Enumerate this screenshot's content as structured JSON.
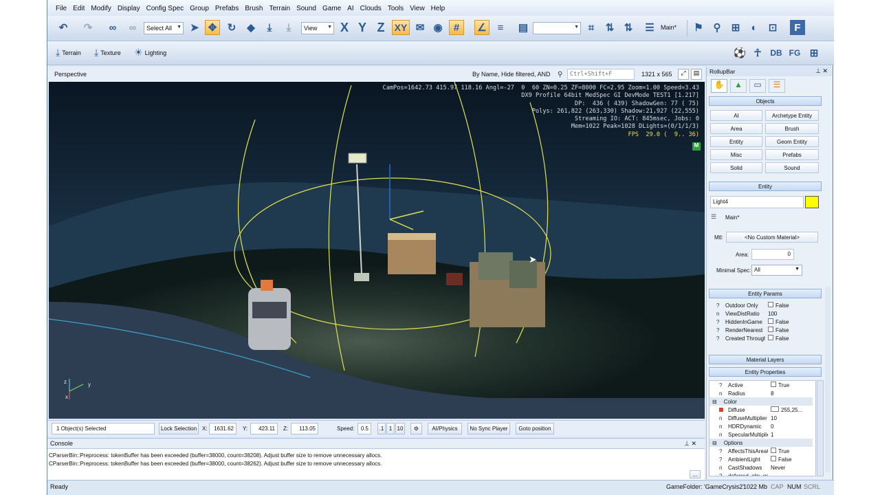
{
  "menu": [
    "File",
    "Edit",
    "Modify",
    "Display",
    "Config Spec",
    "Group",
    "Prefabs",
    "Brush",
    "Terrain",
    "Sound",
    "Game",
    "AI",
    "Clouds",
    "Tools",
    "View",
    "Help"
  ],
  "toolbar": {
    "select_mode": "Select All",
    "coord_system": "View",
    "axis_x": "X",
    "axis_y": "Y",
    "axis_z": "Z",
    "axis_xy": "XY",
    "layer": "Main*"
  },
  "toolbar2": {
    "terrain": "Terrain",
    "texture": "Texture",
    "lighting": "Lighting",
    "db": "DB",
    "fg": "FG"
  },
  "viewport": {
    "title": "Perspective",
    "filter": "By Name, Hide filtered, AND",
    "search_placeholder": "Ctrl+Shift+F",
    "resolution": "1321 x 565",
    "osd_lines": [
      "CamPos=1642.73 415.97 118.16 Angl=-27  0  60 ZN=0.25 ZF=8000 FC=2.95 Zoom=1.00 Speed=3.43",
      "DX9 Profile 64bit MedSpec GI DevMode TEST1 [1.217]",
      "DP:  436 ( 439) ShadowGen: 77 ( 75)",
      "Polys: 261,822 (263,330) Shadow:21,927 (22,555)",
      "Streaming IO: ACT: 845msec, Jobs: 0",
      "Mem=1022 Peak=1028 DLights=(0/1/1/3)"
    ],
    "fps": "FPS  29.0 (  9.. 36)",
    "m_badge": "M",
    "gizmo_z": "z",
    "gizmo_y": "y",
    "gizmo_x": "x"
  },
  "statusbar": {
    "selected": "1 Object(s) Selected",
    "lock": "Lock Selection",
    "x_label": "X:",
    "x": "1631.62",
    "y_label": "Y:",
    "y": "423.11",
    "z_label": "Z:",
    "z": "113.05",
    "speed_label": "Speed:",
    "speed": "0.5",
    "speed_opts": [
      ".1",
      "1",
      "10"
    ],
    "ai_physics": "AI/Physics",
    "no_sync": "No Sync Player",
    "goto": "Goto position"
  },
  "console": {
    "title": "Console",
    "lines": [
      "CParserBin::Preprocess: tokenBuffer has been exceeded (buffer=38000, count=38208). Adjust buffer size to remove unnecessary allocs.",
      "CParserBin::Preprocess: tokenBuffer has been exceeded (buffer=38000, count=38262). Adjust buffer size to remove unnecessary allocs."
    ],
    "more_button": "..."
  },
  "bottom": {
    "ready": "Ready",
    "game_folder": "GameFolder: 'GameCrysis2'",
    "mem": "1022 Mb",
    "cap": "CAP",
    "num": "NUM",
    "scrl": "SCRL"
  },
  "rollup": {
    "title": "RollupBar",
    "objects_header": "Objects",
    "object_buttons": [
      "AI",
      "Archetype Entity",
      "Area",
      "Brush",
      "Entity",
      "Geom Entity",
      "Misc",
      "Prefabs",
      "Solid",
      "Sound"
    ],
    "entity_header": "Entity",
    "entity_name": "Light4",
    "entity_color": "#ffff00",
    "layer": "Main*",
    "mtl_label": "Mtl:",
    "mtl_value": "<No Custom Material>",
    "area_label": "Area:",
    "area_value": "0",
    "minspec_label": "Minimal Spec:",
    "minspec_value": "All",
    "entity_params_header": "Entity Params",
    "entity_params": [
      {
        "icon": "?",
        "name": "Outdoor Only",
        "value": "False",
        "check": true
      },
      {
        "icon": "n",
        "name": "ViewDistRatio",
        "value": "100",
        "check": false
      },
      {
        "icon": "?",
        "name": "HiddenInGame",
        "value": "False",
        "check": true
      },
      {
        "icon": "?",
        "name": "RenderNearest",
        "value": "False",
        "check": true
      },
      {
        "icon": "?",
        "name": "Created Through Pool",
        "value": "False",
        "check": true
      }
    ],
    "material_layers_header": "Material Layers",
    "entity_props_header": "Entity Properties",
    "entity_props": [
      {
        "icon": "?",
        "name": "Active",
        "value": "True",
        "check": true
      },
      {
        "icon": "n",
        "name": "Radius",
        "value": "8",
        "check": false
      }
    ],
    "color_group": "Color",
    "color_props": [
      {
        "icon": "sw",
        "name": "Diffuse",
        "value": "255,25...",
        "check": false
      },
      {
        "icon": "n",
        "name": "DiffuseMultiplier",
        "value": "10",
        "check": false
      },
      {
        "icon": "n",
        "name": "HDRDynamic",
        "value": "0",
        "check": false
      },
      {
        "icon": "n",
        "name": "SpecularMultiplier",
        "value": "1",
        "check": false
      }
    ],
    "options_group": "Options",
    "option_props": [
      {
        "icon": "?",
        "name": "AffectsThisAreaOnly",
        "value": "True",
        "check": true
      },
      {
        "icon": "?",
        "name": "AmbientLight",
        "value": "False",
        "check": true
      },
      {
        "icon": "n",
        "name": "CastShadows",
        "value": "Never",
        "check": false
      },
      {
        "icon": "?",
        "name": "deferred_clip_geom",
        "value": "",
        "check": false
      }
    ]
  }
}
